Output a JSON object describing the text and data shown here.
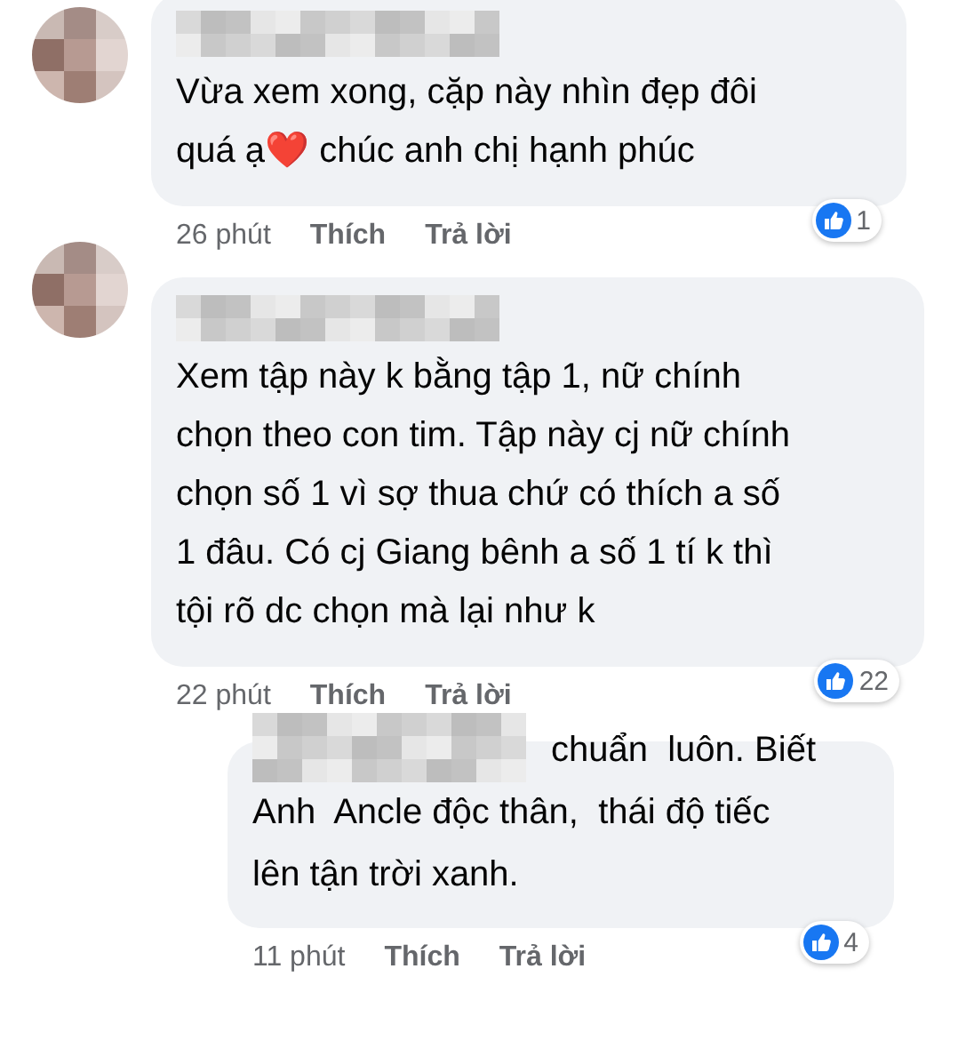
{
  "comments": [
    {
      "text": "Vừa xem xong, cặp này nhìn đẹp đôi\nquá ạ❤️ chúc anh chị hạnh phúc",
      "time": "26 phút",
      "like": "Thích",
      "reply": "Trả lời",
      "reactions": "1"
    },
    {
      "text": "Xem tập này k bằng tập 1, nữ chính\nchọn theo con tim. Tập này cj nữ chính\nchọn số 1 vì sợ thua chứ có thích a số\n1 đâu. Có cj Giang bênh a số 1 tí k thì\ntội rõ dc chọn mà lại như k",
      "time": "22 phút",
      "like": "Thích",
      "reply": "Trả lời",
      "reactions": "22",
      "children": [
        {
          "lines": [
            "chuẩn  luôn. Biết",
            "Anh  Ancle độc thân,  thái độ tiếc",
            "lên tận trời xanh."
          ],
          "time": "11 phút",
          "like": "Thích",
          "reply": "Trả lời",
          "reactions": "4"
        }
      ]
    }
  ]
}
